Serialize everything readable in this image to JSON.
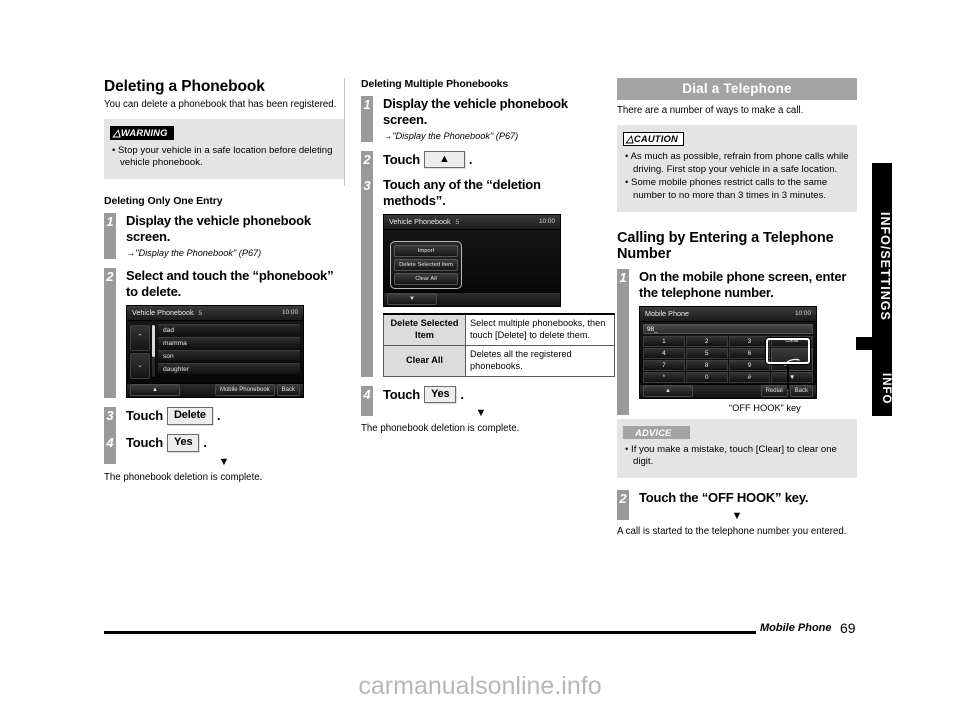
{
  "page": {
    "footer_section": "Mobile Phone",
    "footer_page_number": "69",
    "watermark": "carmanualsonline.info"
  },
  "side_tabs": [
    {
      "label": "INFO/SETTINGS"
    },
    {
      "label": "INFO"
    }
  ],
  "column1": {
    "heading": "Deleting a Phonebook",
    "intro": "You can delete a phonebook that has been registered.",
    "warning": {
      "label": "WARNING",
      "items": [
        "Stop your vehicle in a safe location before deleting vehicle phonebook."
      ]
    },
    "subheading": "Deleting Only One Entry",
    "steps": [
      {
        "num": "1",
        "title": "Display the vehicle phonebook screen.",
        "ref": "→\"Display the Phonebook\" (P67)"
      },
      {
        "num": "2",
        "title": "Select and touch the “phonebook” to delete."
      },
      {
        "num": "3",
        "title_prefix": "Touch",
        "key": "Delete",
        "title_suffix": "."
      },
      {
        "num": "4",
        "title_prefix": "Touch",
        "key": "Yes",
        "title_suffix": "."
      }
    ],
    "arrow": "▼",
    "result": "The phonebook deletion is complete.",
    "screen": {
      "title": "Vehicle Phonebook",
      "count": "5",
      "clock": "10:00",
      "up_arrow": "⌃",
      "down_arrow": "⌄",
      "list": [
        "dad",
        "mamma",
        "son",
        "daughter"
      ],
      "footer_buttons": [
        "▲",
        "Mobile Phonebook",
        "Back"
      ]
    }
  },
  "column2": {
    "subheading": "Deleting Multiple Phonebooks",
    "steps": [
      {
        "num": "1",
        "title": "Display the vehicle phonebook screen.",
        "ref": "→\"Display the Phonebook\" (P67)"
      },
      {
        "num": "2",
        "title_prefix": "Touch",
        "key": "▲",
        "title_suffix": "."
      },
      {
        "num": "3",
        "title": "Touch any of the “deletion methods”."
      },
      {
        "num": "4",
        "title_prefix": "Touch",
        "key": "Yes",
        "title_suffix": "."
      }
    ],
    "arrow": "▼",
    "result": "The phonebook deletion is complete.",
    "screen": {
      "title": "Vehicle Phonebook",
      "count": "5",
      "clock": "10:00",
      "popup_items": [
        "Import",
        "Delete Selected Item",
        "Clear All"
      ],
      "footer_button": "▼"
    },
    "table": {
      "rows": [
        {
          "key": "Delete Selected Item",
          "value": "Select multiple phonebooks, then touch [Delete] to delete them."
        },
        {
          "key": "Clear All",
          "value": "Deletes all the registered phonebooks."
        }
      ]
    }
  },
  "column3": {
    "section_title": "Dial a Telephone",
    "intro": "There are a number of ways to make a call.",
    "caution": {
      "label": "CAUTION",
      "items": [
        "As much as possible, refrain from phone calls while driving. First stop your vehicle in a safe location.",
        "Some mobile phones restrict calls to the same number to no more than 3 times in 3 minutes."
      ]
    },
    "heading": "Calling by Entering a Telephone Number",
    "steps": [
      {
        "num": "1",
        "title": "On the mobile phone screen, enter the telephone number."
      },
      {
        "num": "2",
        "title": "Touch the “OFF HOOK” key."
      }
    ],
    "callout_label": "“OFF HOOK” key",
    "advice": {
      "label": "ADVICE",
      "items": [
        "If you make a mistake, touch [Clear] to clear one digit."
      ]
    },
    "arrow": "▼",
    "result": "A call is started to the telephone number you entered.",
    "screen": {
      "title": "Mobile Phone",
      "clock": "10:00",
      "input_value": "98_",
      "keys": [
        "1",
        "2",
        "3",
        "Clear",
        "4",
        "5",
        "6",
        "7",
        "8",
        "9",
        "*",
        "0",
        "#",
        "▼"
      ],
      "footer_buttons": [
        "▲",
        "Redial",
        "Back"
      ]
    }
  }
}
